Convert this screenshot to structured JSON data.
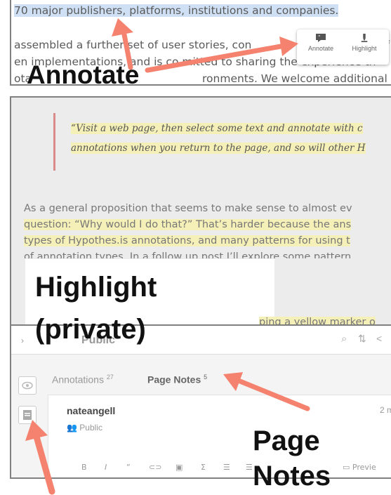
{
  "panel1": {
    "line1": "70 major publishers, platforms, institutions and companies.",
    "line2a": "assembled a further set of user stories, con",
    "line2b": "of",
    "line3a": "en implementations, and is co",
    "line3b": "mitted to sharing the experience th",
    "line4": "ota",
    "line4b": "ronments. We welcome additional me",
    "annotate_btn": "Annotate",
    "highlight_btn": "Highlight",
    "label": "Annotate"
  },
  "panel2": {
    "quote1": "“Visit a web page, then select some text and annotate with c",
    "quote2": "annotations when you return to the page, and so will other H",
    "body1": "As a general proposition that seems to make sense to almost ev",
    "body2": "question: “Why would I do that?” That’s harder because the ans",
    "body3": "types of Hypothes.is annotations, and many patterns for using t",
    "body4": "of annotation types. In a follow up post I’ll explore some pattern",
    "body5": "ping a yellow marker o",
    "label1": "Highlight",
    "label2": "(private)"
  },
  "panel3": {
    "scope": "Public",
    "tab_annotations": "Annotations",
    "annotations_count": "27",
    "tab_pagenotes": "Page Notes",
    "pagenotes_count": "5",
    "username": "nateangell",
    "privacy": "Public",
    "time": "2 m",
    "preview": "Previe",
    "label1": "Page",
    "label2": "Notes"
  },
  "colors": {
    "arrow": "#f4826e",
    "selection": "#cfe0f5",
    "highlight": "#f5f0b8"
  }
}
